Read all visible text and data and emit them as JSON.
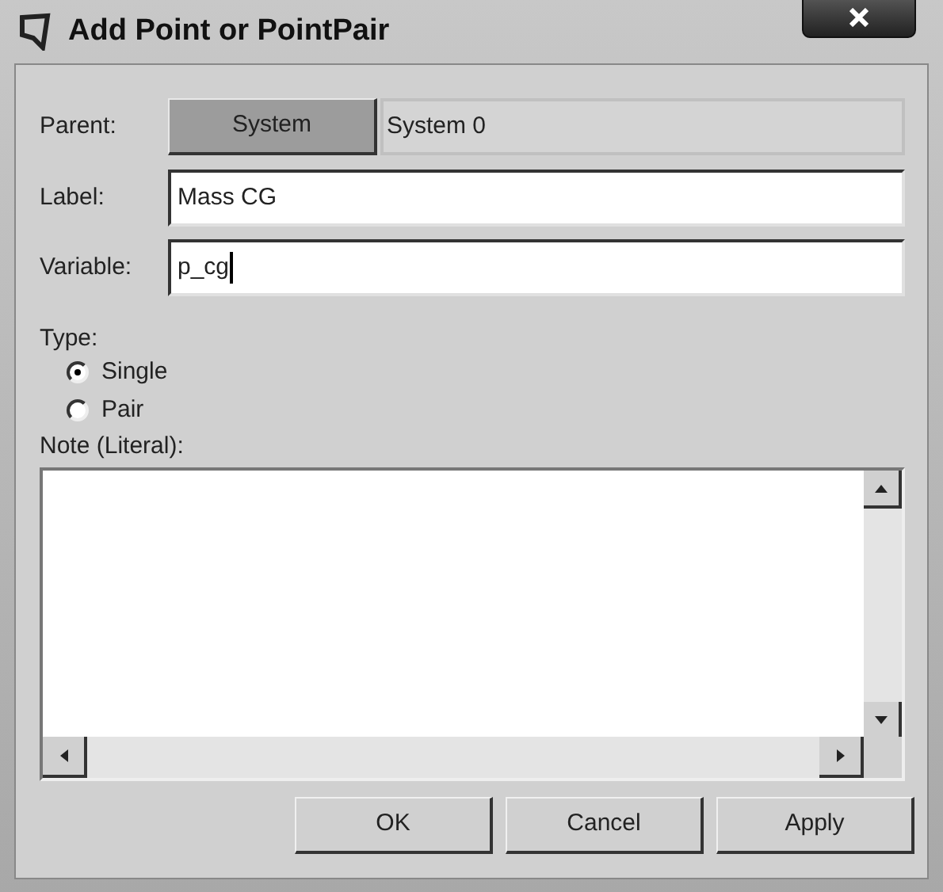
{
  "window": {
    "title": "Add Point or PointPair"
  },
  "parent": {
    "label": "Parent:",
    "button": "System",
    "value": "System 0"
  },
  "fields": [
    {
      "label": "Label:",
      "value": "Mass CG",
      "focused": false
    },
    {
      "label": "Variable:",
      "value": "p_cg",
      "focused": true
    }
  ],
  "type": {
    "label": "Type:",
    "options": [
      {
        "label": "Single",
        "selected": true
      },
      {
        "label": "Pair",
        "selected": false
      }
    ]
  },
  "note": {
    "label": "Note (Literal):"
  },
  "buttons": [
    "OK",
    "Cancel",
    "Apply"
  ]
}
